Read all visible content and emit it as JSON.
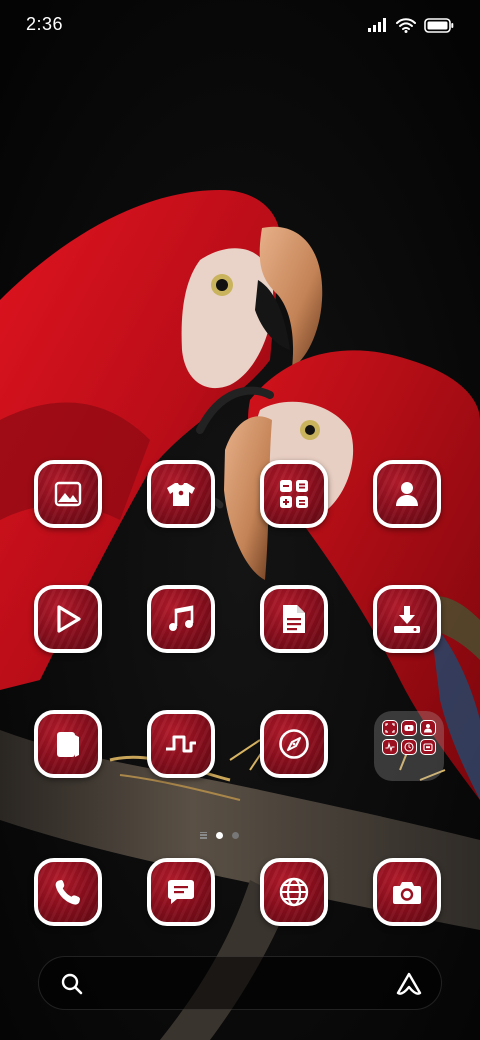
{
  "status_bar": {
    "time": "2:36",
    "icons": [
      "signal-icon",
      "wifi-icon",
      "battery-icon"
    ]
  },
  "wallpaper": {
    "subject": "two-red-macaws",
    "colors": {
      "background": "#070707",
      "feather": "#c8101e",
      "beak": "#c8895a",
      "branch": "#3b352e"
    }
  },
  "home_grid": {
    "rows": [
      [
        "gallery-icon",
        "themes-icon",
        "calculator-icon",
        "contacts-icon"
      ],
      [
        "video-icon",
        "music-icon",
        "notes-icon",
        "downloads-icon"
      ],
      [
        "wallet-icon",
        "pulse-icon",
        "compass-icon",
        "folder"
      ]
    ],
    "folder_apps": [
      "screenshot-icon",
      "youtube-icon",
      "contacts-icon",
      "pulse-icon",
      "clock-icon",
      "settings-icon"
    ]
  },
  "page_indicator": {
    "pages": 2,
    "current": 1
  },
  "dock": [
    "phone-icon",
    "messages-icon",
    "browser-icon",
    "camera-icon"
  ],
  "search_bar": {
    "left_icon": "search-icon",
    "right_icon": "assistant-icon"
  },
  "theme": {
    "icon_fill": "#9a1020",
    "icon_border": "#ffffff"
  }
}
